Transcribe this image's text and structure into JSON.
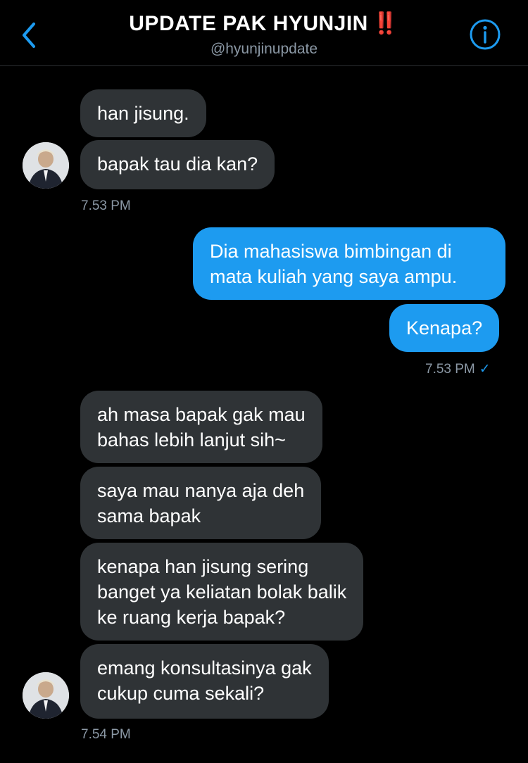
{
  "header": {
    "title": "UPDATE PAK HYUNJIN",
    "title_emoji": "‼️",
    "handle": "@hyunjinupdate"
  },
  "icons": {
    "back": "chevron-left-icon",
    "info": "info-icon",
    "read": "checkmark-icon"
  },
  "colors": {
    "background": "#000000",
    "received_bubble": "#2f3336",
    "sent_bubble": "#1d9bf0",
    "accent": "#1d9bf0",
    "muted_text": "#8b98a5"
  },
  "messages": {
    "m1": "han jisung.",
    "m2": "bapak tau dia kan?",
    "t1": "7.53 PM",
    "m3": "Dia mahasiswa bimbingan di\nmata kuliah yang saya ampu.",
    "m4": "Kenapa?",
    "t2": "7.53 PM",
    "t2_check": "✓",
    "m5": "ah masa bapak gak mau\nbahas lebih lanjut sih~",
    "m6": "saya mau nanya aja deh\nsama bapak",
    "m7": "kenapa han jisung sering\nbanget ya keliatan bolak balik\nke ruang kerja bapak?",
    "m8": "emang konsultasinya gak\ncukup cuma sekali?",
    "t3": "7.54 PM"
  }
}
